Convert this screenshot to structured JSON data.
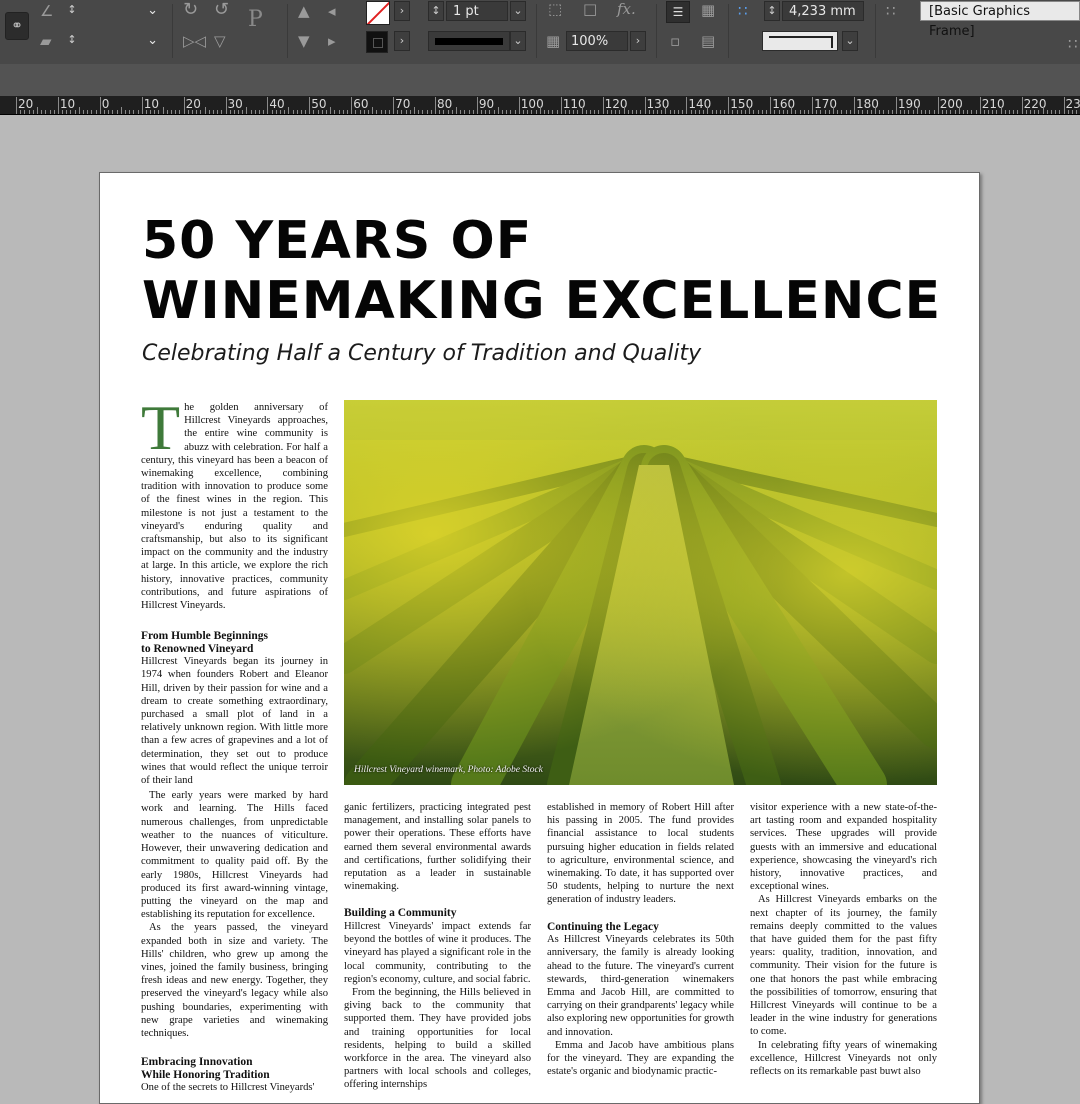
{
  "control_panel": {
    "stroke_weight": "1 pt",
    "scale_percent": "100%",
    "dimension_value": "4,233 mm",
    "object_style": "[Basic Graphics Frame]"
  },
  "ruler": {
    "labels": [
      "20",
      "10",
      "0",
      "10",
      "20",
      "30",
      "40",
      "50",
      "60",
      "70",
      "80",
      "90",
      "100",
      "110",
      "120",
      "130",
      "140",
      "150",
      "160",
      "170",
      "180",
      "190",
      "200",
      "210",
      "220",
      "230"
    ]
  },
  "article": {
    "title_line1": "50 YEARS OF",
    "title_line2": "WINEMAKING EXCELLENCE",
    "subtitle": "Celebrating Half a Century of Tradition and Quality",
    "dropcap": "T",
    "intro": "he golden anniversary of Hillcrest Vineyards approaches, the entire wine community is abuzz with celebration. For half a century, this vineyard has been a beacon of winemaking excellence, combining tradition with innovation to produce some of the finest wines in the region. This milestone is not just a testament to the vineyard's enduring quality and craftsmanship, but also to its significant impact on the community and the industry at large. In this article, we explore the rich history, innovative practices, community contributions, and future aspirations of Hillcrest Vineyards.",
    "h1_line1": "From Humble Beginnings",
    "h1_line2": "to Renowned Vineyard",
    "p1": "Hillcrest Vineyards began its journey in 1974 when founders Robert and Eleanor Hill, driven by their passion for wine and a dream to create something extraordinary, purchased a small plot of land in a relatively unknown region. With little more than a few acres of grapevines and a lot of determination, they set out to produce wines that would reflect the unique terroir of their land",
    "p2": "The early years were marked by hard work and learning. The Hills faced numerous challenges, from unpredictable weather to the nuances of viticulture. However, their unwavering dedication and commitment to quality paid off. By the early 1980s, Hillcrest Vineyards had produced its first award-winning vintage, putting the vineyard on the map and establishing its reputation for excellence.",
    "p3": "As the years passed, the vineyard expanded both in size and variety. The Hills' children, who grew up among the vines, joined the family business, bringing fresh ideas and new energy. Together, they preserved the vineyard's legacy while also pushing boundaries, experimenting with new grape varieties and winemaking techniques.",
    "h2_line1": "Embracing Innovation",
    "h2_line2": "While Honoring Tradition",
    "p4": "One of the secrets to Hillcrest Vineyards'",
    "col2_p1": "ganic fertilizers, practicing integrated pest management, and installing solar panels to power their operations. These efforts have earned them several environmental awards and certifications, further solidifying their reputation as a leader in sustainable winemaking.",
    "h3": "Building a Community",
    "col2_p2": "Hillcrest Vineyards' impact extends far beyond the bottles of wine it produces. The vineyard has played a significant role in the local community, contributing to the region's economy, culture, and social fabric.",
    "col2_p3": "From the beginning, the Hills believed in giving back to the community that supported them. They have provided jobs and training opportunities for local residents, helping to build a skilled workforce in the area. The vineyard also partners with local schools and colleges, offering internships",
    "col3_p1": "established in memory of Robert Hill after his passing in 2005. The fund provides financial assistance to local students pursuing higher education in fields related to agriculture, environmental science, and winemaking. To date, it has supported over 50 students, helping to nurture the next generation of industry leaders.",
    "h4": "Continuing the Legacy",
    "col3_p2": "As Hillcrest Vineyards celebrates its 50th anniversary, the family is already looking ahead to the future. The vineyard's current stewards, third-generation winemakers Emma and Jacob Hill, are committed to carrying on their grandparents' legacy while also exploring new opportunities for growth and innovation.",
    "col3_p3": "Emma and Jacob have ambitious plans for the vineyard. They are expanding the estate's organic and biodynamic practic-",
    "col4_p1": "visitor experience with a new state-of-the-art tasting room and expanded hospitality services. These upgrades will provide guests with an immersive and educational experience, showcasing the vineyard's rich history, innovative practices, and exceptional wines.",
    "col4_p2": "As Hillcrest Vineyards embarks on the next chapter of its journey, the family remains deeply committed to the values that have guided them for the past fifty years: quality, tradition, innovation, and community. Their vision for the future is one that honors the past while embracing the possibilities of tomorrow, ensuring that Hillcrest Vineyards will continue to be a leader in the wine industry for generations to come.",
    "col4_p3": "In celebrating fifty years of winemaking excellence, Hillcrest Vineyards not only reflects on its remarkable past buwt also",
    "photo_caption": "Hillcrest Vineyard winemark, Photo: Adobe Stock"
  },
  "colors": {
    "dropcap": "#3f7a3a",
    "panel": "#484848",
    "pasteboard": "#b9b9b9"
  }
}
